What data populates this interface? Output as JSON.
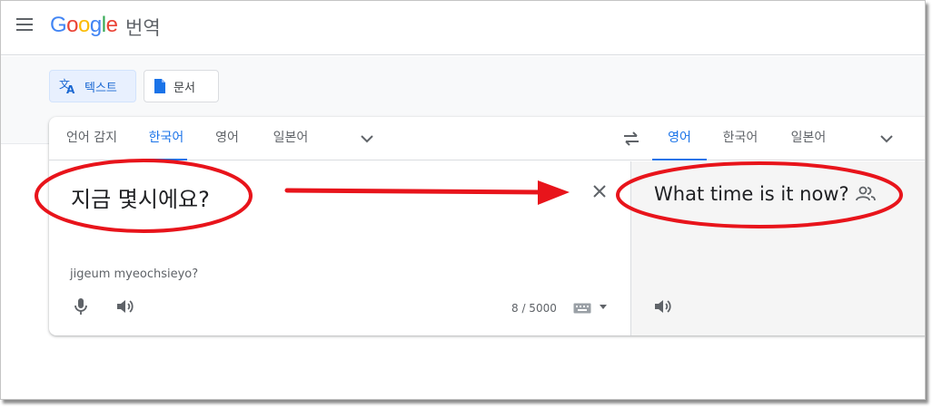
{
  "header": {
    "logo_letters": [
      "G",
      "o",
      "o",
      "g",
      "l",
      "e"
    ],
    "product": "번역"
  },
  "modes": {
    "text_label": "텍스트",
    "document_label": "문서"
  },
  "source_languages": {
    "detect": "언어 감지",
    "korean": "한국어",
    "english": "영어",
    "japanese": "일본어",
    "selected": "한국어"
  },
  "target_languages": {
    "english": "영어",
    "korean": "한국어",
    "japanese": "일본어",
    "selected": "영어"
  },
  "source": {
    "text": "지금 몇시에요?",
    "transliteration": "jigeum myeochsieyo?",
    "char_count": "8 / 5000"
  },
  "target": {
    "text": "What time is it now?"
  },
  "colors": {
    "accent": "#1a73e8",
    "annotation_red": "#e8141b"
  },
  "icons": [
    "menu-icon",
    "translate-icon",
    "document-icon",
    "chevron-down-icon",
    "swap-icon",
    "close-icon",
    "mic-icon",
    "speaker-icon",
    "keyboard-icon",
    "people-icon"
  ]
}
